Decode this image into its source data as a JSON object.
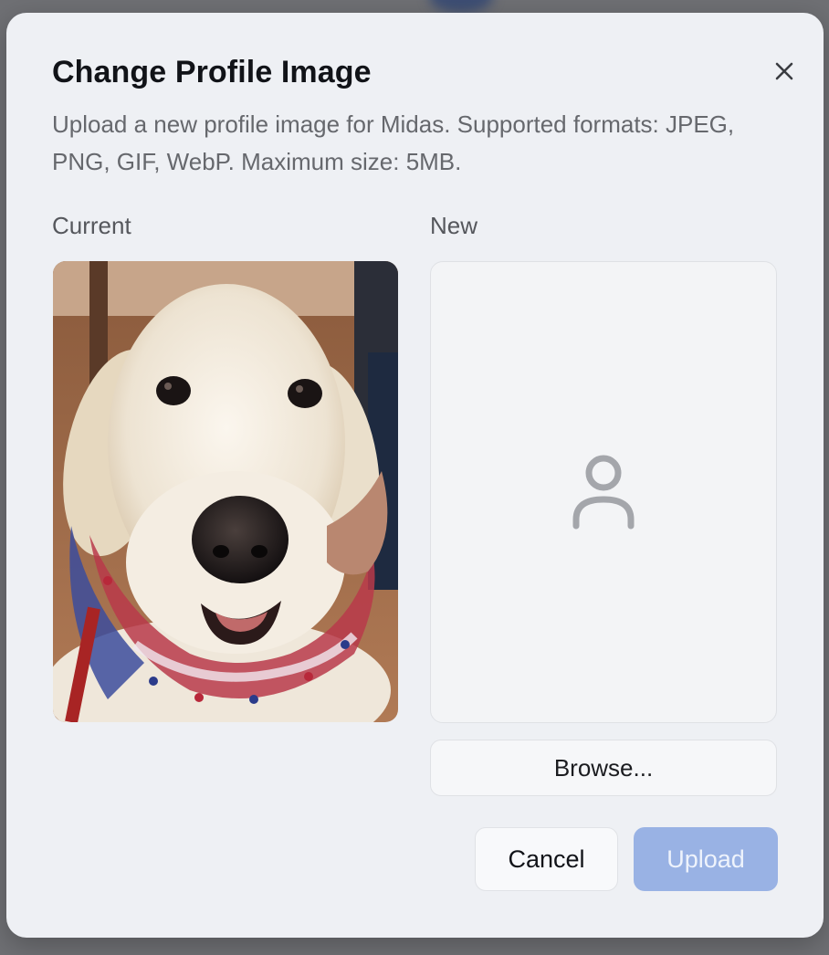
{
  "dialog": {
    "title": "Change Profile Image",
    "description": "Upload a new profile image for Midas. Supported formats: JPEG, PNG, GIF, WebP. Maximum size: 5MB.",
    "close_icon": "close-icon"
  },
  "current": {
    "label": "Current",
    "image_subject": "white dog wearing a red, white and blue star collar"
  },
  "new": {
    "label": "New",
    "placeholder_icon": "person-icon"
  },
  "browse_label": "Browse...",
  "actions": {
    "cancel_label": "Cancel",
    "upload_label": "Upload",
    "upload_enabled": false
  },
  "colors": {
    "dialog_bg": "#eef0f4",
    "upload_disabled": "#99b2e4",
    "title_text": "#111318"
  }
}
